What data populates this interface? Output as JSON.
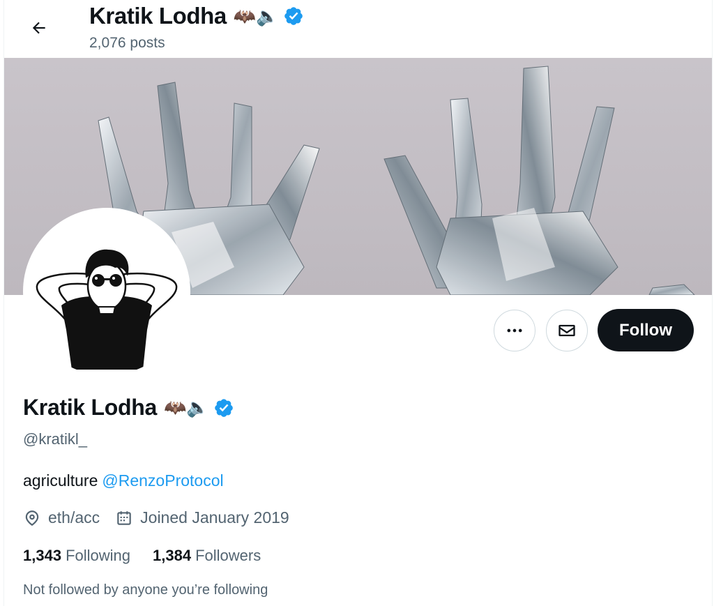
{
  "header": {
    "name": "Kratik Lodha",
    "name_emojis": "🦇🔈",
    "posts_count": "2,076",
    "posts_label": "posts"
  },
  "profile": {
    "name": "Kratik Lodha",
    "name_emojis": "🦇🔈",
    "handle": "@kratikl_",
    "bio_text": "agriculture",
    "bio_mention": "@RenzoProtocol",
    "location": "eth/acc",
    "joined": "Joined January 2019",
    "following_count": "1,343",
    "following_label": "Following",
    "followers_count": "1,384",
    "followers_label": "Followers",
    "not_followed_note": "Not followed by anyone you’re following"
  },
  "actions": {
    "follow_label": "Follow"
  },
  "icons": {
    "back": "arrow-left-icon",
    "verified": "verified-badge-icon",
    "more": "more-horizontal-icon",
    "message": "envelope-icon",
    "location": "location-pin-icon",
    "calendar": "calendar-icon"
  },
  "colors": {
    "accent": "#1d9bf0",
    "text_primary": "#0f1419",
    "text_secondary": "#536471",
    "follow_button": "#0f1419",
    "border": "#cfd9de"
  }
}
